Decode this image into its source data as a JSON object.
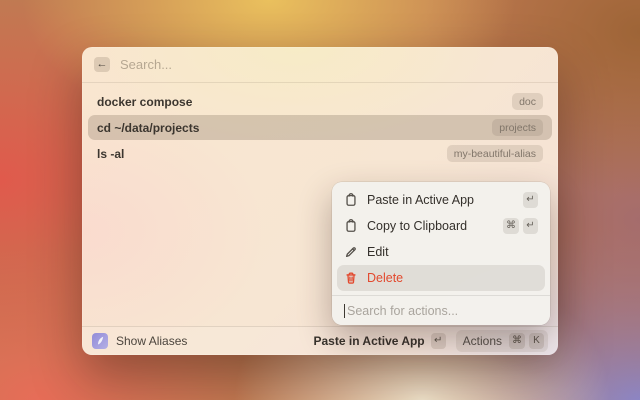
{
  "window": {
    "search": {
      "placeholder": "Search..."
    },
    "back_glyph": "←",
    "list": {
      "rows": [
        {
          "label": "docker compose",
          "tag": "doc"
        },
        {
          "label": "cd ~/data/projects",
          "tag": "projects"
        },
        {
          "label": "ls -al",
          "tag": "my-beautiful-alias"
        }
      ],
      "selected_index": 1
    },
    "footer": {
      "app_label": "Show Aliases",
      "primary_action_label": "Paste in Active App",
      "primary_action_key": "↵",
      "actions_label": "Actions",
      "actions_keys": [
        "⌘",
        "K"
      ]
    }
  },
  "actions_menu": {
    "items": [
      {
        "icon": "clipboard-icon",
        "label": "Paste in Active App",
        "keys": [
          "↵"
        ]
      },
      {
        "icon": "clipboard-icon",
        "label": "Copy to Clipboard",
        "keys": [
          "⌘",
          "↵"
        ]
      },
      {
        "icon": "pencil-icon",
        "label": "Edit",
        "keys": []
      },
      {
        "icon": "trash-icon",
        "label": "Delete",
        "keys": [],
        "danger": true,
        "selected": true
      }
    ],
    "search_placeholder": "Search for actions..."
  },
  "colors": {
    "danger": "#e2492e",
    "app_icon": "#928bd8",
    "selection": "rgba(133,115,95,0.30)"
  }
}
